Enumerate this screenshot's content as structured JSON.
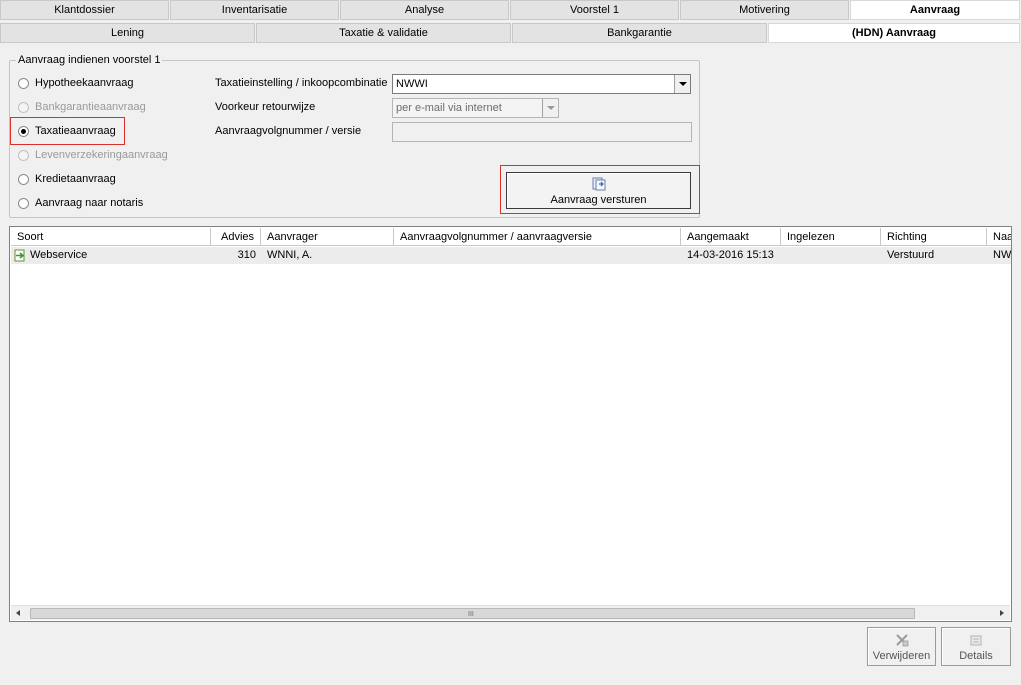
{
  "tabs_row1": [
    {
      "label": "Klantdossier",
      "active": false
    },
    {
      "label": "Inventarisatie",
      "active": false
    },
    {
      "label": "Analyse",
      "active": false
    },
    {
      "label": "Voorstel 1",
      "active": false
    },
    {
      "label": "Motivering",
      "active": false
    },
    {
      "label": "Aanvraag",
      "active": true
    }
  ],
  "tabs_row2": [
    {
      "label": "Lening",
      "active": false
    },
    {
      "label": "Taxatie & validatie",
      "active": false
    },
    {
      "label": "Bankgarantie",
      "active": false
    },
    {
      "label": "(HDN) Aanvraag",
      "active": true
    }
  ],
  "group": {
    "legend": "Aanvraag indienen voorstel 1",
    "radios": [
      {
        "label": "Hypotheekaanvraag",
        "checked": false,
        "enabled": true
      },
      {
        "label": "Bankgarantieaanvraag",
        "checked": false,
        "enabled": false
      },
      {
        "label": "Taxatieaanvraag",
        "checked": true,
        "enabled": true
      },
      {
        "label": "Levenverzekeringaanvraag",
        "checked": false,
        "enabled": false
      },
      {
        "label": "Kredietaanvraag",
        "checked": false,
        "enabled": true
      },
      {
        "label": "Aanvraag naar notaris",
        "checked": false,
        "enabled": true
      }
    ],
    "fields": {
      "taxatie_label": "Taxatieinstelling / inkoopcombinatie",
      "taxatie_value": "NWWI",
      "retour_label": "Voorkeur retourwijze",
      "retour_value": "per e-mail via internet",
      "volgnummer_label": "Aanvraagvolgnummer / versie",
      "volgnummer_value": ""
    },
    "send_button": "Aanvraag versturen"
  },
  "table": {
    "columns": [
      "Soort",
      "Advies",
      "Aanvrager",
      "Aanvraagvolgnummer / aanvraagversie",
      "Aangemaakt",
      "Ingelezen",
      "Richting",
      "Naa"
    ],
    "rows": [
      {
        "soort": "Webservice",
        "advies": "310",
        "aanvrager": "WNNI, A.",
        "volgnummer": "",
        "aangemaakt": "14-03-2016 15:13",
        "ingelezen": "",
        "richting": "Verstuurd",
        "naar": "NWI"
      }
    ],
    "scroll_grip": "III"
  },
  "buttons": {
    "verwijderen": "Verwijderen",
    "details": "Details"
  },
  "colors": {
    "highlight_border": "#d9302a",
    "active_tab": "#ffffff",
    "inactive_tab": "#e3e3e3"
  }
}
